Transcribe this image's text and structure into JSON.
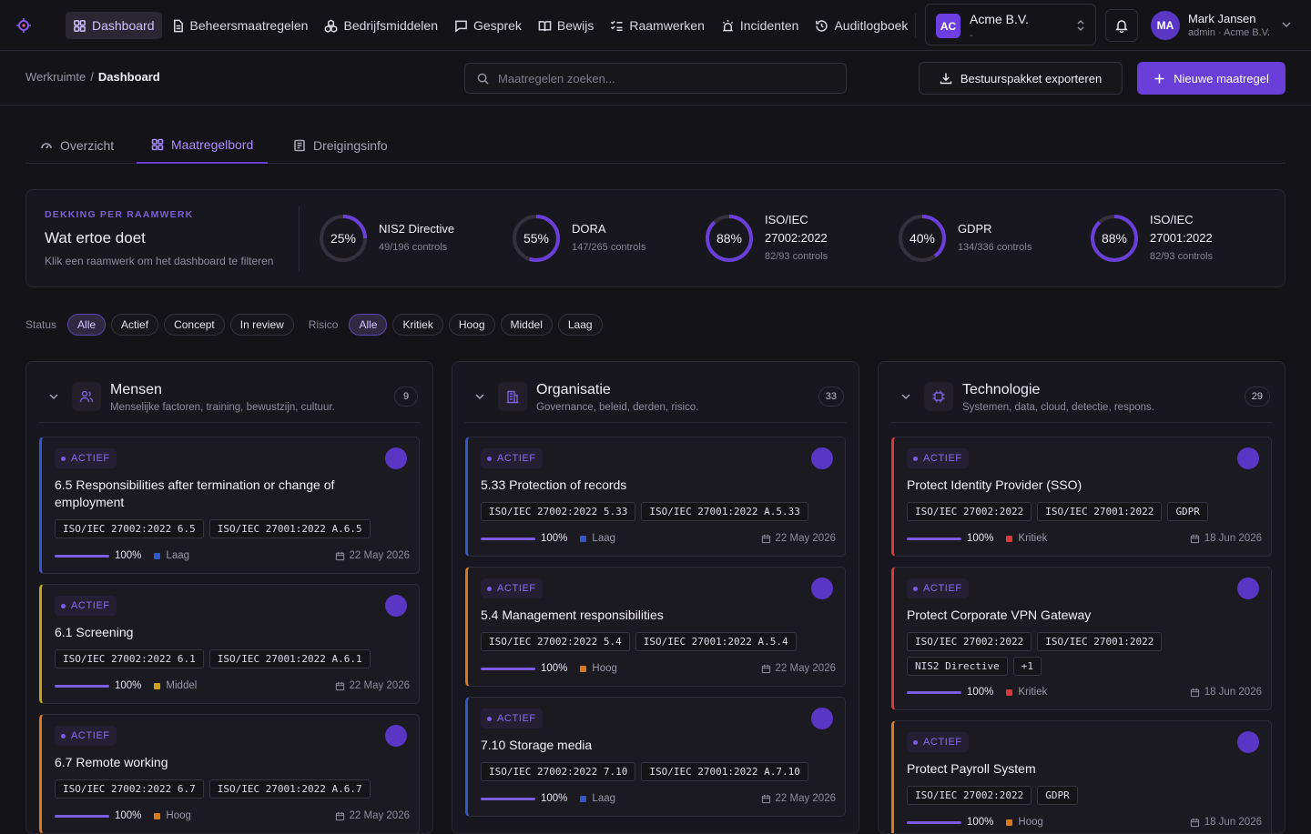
{
  "nav": [
    {
      "label": "Dashboard",
      "icon": "grid-icon",
      "active": true
    },
    {
      "label": "Beheersmaatregelen",
      "icon": "document-icon"
    },
    {
      "label": "Bedrijfsmiddelen",
      "icon": "cubes-icon"
    },
    {
      "label": "Gesprek",
      "icon": "chat-icon"
    },
    {
      "label": "Bewijs",
      "icon": "book-icon"
    },
    {
      "label": "Raamwerken",
      "icon": "checklist-icon"
    },
    {
      "label": "Incidenten",
      "icon": "siren-icon"
    },
    {
      "label": "Auditlogboek",
      "icon": "history-icon"
    }
  ],
  "org": {
    "badge": "AC",
    "name": "Acme B.V.",
    "sub": "-"
  },
  "user": {
    "initials": "MA",
    "name": "Mark Jansen",
    "sub": "admin · Acme B.V."
  },
  "breadcrumb": {
    "root": "Werkruimte",
    "sep": "/",
    "current": "Dashboard"
  },
  "search": {
    "placeholder": "Maatregelen zoeken..."
  },
  "actions": {
    "export": "Bestuurspakket exporteren",
    "new": "Nieuwe maatregel"
  },
  "tabs": [
    {
      "label": "Overzicht",
      "icon": "gauge-icon"
    },
    {
      "label": "Maatregelbord",
      "icon": "grid-icon",
      "active": true
    },
    {
      "label": "Dreigingsinfo",
      "icon": "newspaper-icon"
    }
  ],
  "coverage": {
    "eyebrow": "DEKKING PER RAAMWERK",
    "title": "Wat ertoe doet",
    "hint": "Klik een raamwerk om het dashboard te filteren",
    "frameworks": [
      {
        "pct_label": "25%",
        "percent": 25,
        "name": "NIS2 Directive",
        "sub": "49/196 controls"
      },
      {
        "pct_label": "55%",
        "percent": 55,
        "name": "DORA",
        "sub": "147/265 controls"
      },
      {
        "pct_label": "88%",
        "percent": 88,
        "name": "ISO/IEC 27002:2022",
        "sub": "82/93 controls"
      },
      {
        "pct_label": "40%",
        "percent": 40,
        "name": "GDPR",
        "sub": "134/336 controls"
      },
      {
        "pct_label": "88%",
        "percent": 88,
        "name": "ISO/IEC 27001:2022",
        "sub": "82/93 controls"
      }
    ]
  },
  "filters": {
    "status_label": "Status",
    "status": [
      {
        "label": "Alle",
        "active": true
      },
      {
        "label": "Actief"
      },
      {
        "label": "Concept"
      },
      {
        "label": "In review"
      }
    ],
    "risk_label": "Risico",
    "risk": [
      {
        "label": "Alle",
        "active": true
      },
      {
        "label": "Kritiek"
      },
      {
        "label": "Hoog"
      },
      {
        "label": "Middel"
      },
      {
        "label": "Laag"
      }
    ]
  },
  "colors": {
    "accent": "#6a3fd9",
    "laag": "#3556c8",
    "middel": "#c9a21a",
    "hoog": "#d8791f",
    "kritiek": "#d83a3a"
  },
  "columns": [
    {
      "title": "Mensen",
      "desc": "Menselijke factoren, training, bewustzijn, cultuur.",
      "count": "9",
      "icon": "users-icon",
      "cards": [
        {
          "badge": "ACTIEF",
          "title": "6.5 Responsibilities after termination or change of employment",
          "tags": [
            "ISO/IEC 27002:2022 6.5",
            "ISO/IEC 27001:2022 A.6.5"
          ],
          "progress": 100,
          "progress_label": "100%",
          "risk": "Laag",
          "date": "22 May 2026"
        },
        {
          "badge": "ACTIEF",
          "title": "6.1 Screening",
          "tags": [
            "ISO/IEC 27002:2022 6.1",
            "ISO/IEC 27001:2022 A.6.1"
          ],
          "progress": 100,
          "progress_label": "100%",
          "risk": "Middel",
          "date": "22 May 2026"
        },
        {
          "badge": "ACTIEF",
          "title": "6.7 Remote working",
          "tags": [
            "ISO/IEC 27002:2022 6.7",
            "ISO/IEC 27001:2022 A.6.7"
          ],
          "progress": 100,
          "progress_label": "100%",
          "risk": "Hoog",
          "date": "22 May 2026"
        }
      ]
    },
    {
      "title": "Organisatie",
      "desc": "Governance, beleid, derden, risico.",
      "count": "33",
      "icon": "building-icon",
      "cards": [
        {
          "badge": "ACTIEF",
          "title": "5.33 Protection of records",
          "tags": [
            "ISO/IEC 27002:2022 5.33",
            "ISO/IEC 27001:2022 A.5.33"
          ],
          "progress": 100,
          "progress_label": "100%",
          "risk": "Laag",
          "date": "22 May 2026"
        },
        {
          "badge": "ACTIEF",
          "title": "5.4 Management responsibilities",
          "tags": [
            "ISO/IEC 27002:2022 5.4",
            "ISO/IEC 27001:2022 A.5.4"
          ],
          "progress": 100,
          "progress_label": "100%",
          "risk": "Hoog",
          "date": "22 May 2026"
        },
        {
          "badge": "ACTIEF",
          "title": "7.10 Storage media",
          "tags": [
            "ISO/IEC 27002:2022 7.10",
            "ISO/IEC 27001:2022 A.7.10"
          ],
          "progress": 100,
          "progress_label": "100%",
          "risk": "Laag",
          "date": "22 May 2026"
        }
      ]
    },
    {
      "title": "Technologie",
      "desc": "Systemen, data, cloud, detectie, respons.",
      "count": "29",
      "icon": "chip-icon",
      "cards": [
        {
          "badge": "ACTIEF",
          "title": "Protect Identity Provider (SSO)",
          "tags": [
            "ISO/IEC 27002:2022",
            "ISO/IEC 27001:2022",
            "GDPR"
          ],
          "progress": 100,
          "progress_label": "100%",
          "risk": "Kritiek",
          "date": "18 Jun 2026"
        },
        {
          "badge": "ACTIEF",
          "title": "Protect Corporate VPN Gateway",
          "tags": [
            "ISO/IEC 27002:2022",
            "ISO/IEC 27001:2022",
            "NIS2 Directive",
            "+1"
          ],
          "progress": 100,
          "progress_label": "100%",
          "risk": "Kritiek",
          "date": "18 Jun 2026"
        },
        {
          "badge": "ACTIEF",
          "title": "Protect Payroll System",
          "tags": [
            "ISO/IEC 27002:2022",
            "GDPR"
          ],
          "progress": 100,
          "progress_label": "100%",
          "risk": "Hoog",
          "date": "18 Jun 2026"
        }
      ]
    }
  ]
}
